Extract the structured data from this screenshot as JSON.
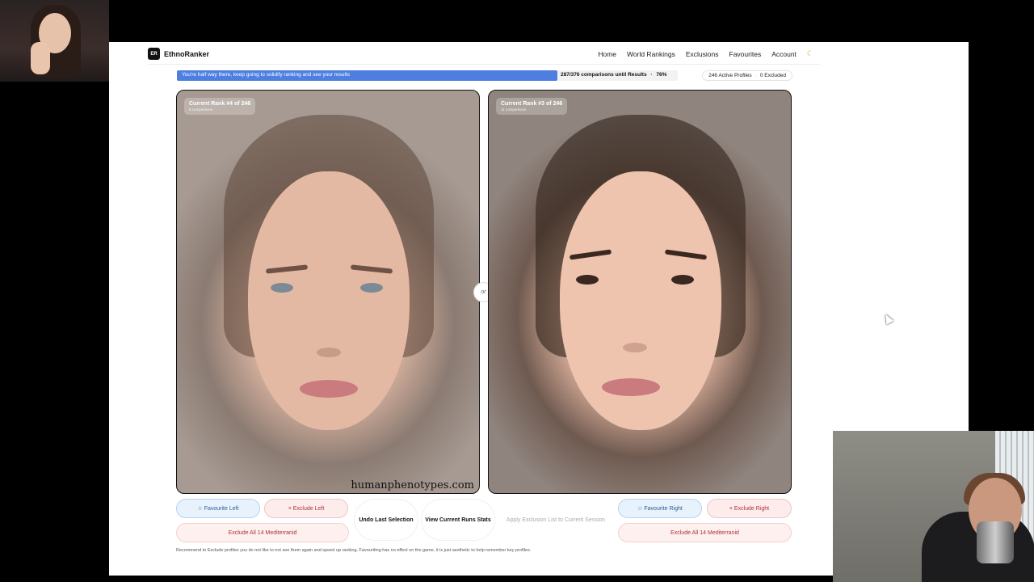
{
  "app": {
    "logo_badge": "ER",
    "name": "EthnoRanker"
  },
  "nav": {
    "items": [
      {
        "label": "Home"
      },
      {
        "label": "World Rankings"
      },
      {
        "label": "Exclusions"
      },
      {
        "label": "Favourites"
      },
      {
        "label": "Account"
      }
    ],
    "theme_icon": "moon-icon"
  },
  "progress": {
    "message": "You're half way there, keep going to solidify ranking and see your results",
    "count_text": "287/376 comparisons until Results",
    "separator": "·",
    "percent_text": "76%",
    "fraction": 0.76,
    "active_profiles": "246 Active Profiles",
    "excluded": "0 Excluded"
  },
  "left_card": {
    "rank": "Current Rank #4 of 246",
    "sub": "8 comparisons",
    "watermark": "humanphenotypes.com"
  },
  "right_card": {
    "rank": "Current Rank #3 of 246",
    "sub": "11 comparisons"
  },
  "divider": {
    "label": "or"
  },
  "buttons": {
    "fav_left": "☆ Favourite Left",
    "exclude_left": "× Exclude Left",
    "undo": "Undo Last Selection",
    "stats": "View Current Runs Stats",
    "apply": "Apply Exclusion List to Current Session",
    "fav_right": "☆ Favourite Right",
    "exclude_right": "× Exclude Right",
    "exclude_all_left": "Exclude All 14 Mediterranid",
    "exclude_all_right": "Exclude All 14 Mediterranid"
  },
  "hint": "Recommend to Exclude profiles you do not like to not see them again and speed up ranking. Favouriting has no effect on the game, it is just aesthetic to help remember key profiles.",
  "colors": {
    "progress_fill": "#4e7fe0",
    "favourite": "#2d5f93",
    "exclude": "#b0313a"
  }
}
